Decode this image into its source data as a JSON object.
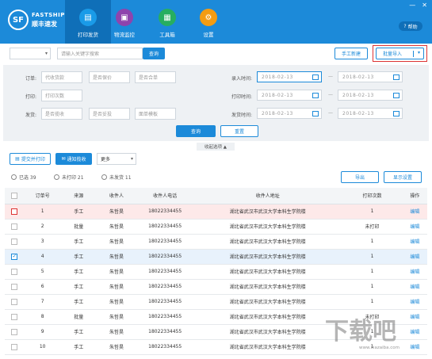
{
  "app": {
    "logo_mark": "SF",
    "logo_en": "FASTSHIP",
    "logo_cn": "顺丰速发"
  },
  "nav": [
    {
      "label": "打印发货",
      "icon": "printer-icon",
      "color": "#1a9be8"
    },
    {
      "label": "物流监控",
      "icon": "monitor-icon",
      "color": "#8e44ad"
    },
    {
      "label": "工具箱",
      "icon": "toolbox-icon",
      "color": "#27ae60"
    },
    {
      "label": "设置",
      "icon": "gear-icon",
      "color": "#f39c12"
    }
  ],
  "window": {
    "minimize": "—",
    "close": "✕"
  },
  "help_label": "帮助",
  "toolbar": {
    "search_placeholder": "请输入关键字搜索",
    "search_btn": "查询",
    "manual_new": "手工新建",
    "batch_import": "批量导入"
  },
  "filters": {
    "order_label": "订单:",
    "order_selects": [
      "代收货款",
      "是否保价",
      "是否合单"
    ],
    "print_label": "打印:",
    "print_selects": [
      "打印次数"
    ],
    "ship_label": "发货:",
    "ship_selects": [
      "是否揽收",
      "是否妥投",
      "面单模板"
    ],
    "entry_time_label": "录入时间:",
    "print_time_label": "打印时间:",
    "ship_time_label": "发货时间:",
    "date_from": "2018-02-13",
    "date_to": "2018-02-13",
    "query_btn": "查询",
    "reset_btn": "重置",
    "collapse": "收起选项 ▲"
  },
  "actions": {
    "submit_print": "提交并打印",
    "notify_pickup": "通知揽收",
    "more": "更多"
  },
  "status_tabs": {
    "selected": "已选 39",
    "unprinted": "未打印 21",
    "unshipped": "未发货 11"
  },
  "right_actions": {
    "export": "导出",
    "display_settings": "显示设置"
  },
  "table": {
    "headers": [
      "订单号",
      "来源",
      "收件人",
      "收件人电话",
      "收件人地址",
      "打印次数",
      "操作"
    ],
    "rows": [
      {
        "no": "1",
        "source": "手工",
        "name": "朱哲昊",
        "phone": "18022334455",
        "addr": "湖北省武汉市武汉大学本科生学院楼",
        "prints": "1",
        "op": "编辑"
      },
      {
        "no": "2",
        "source": "批量",
        "name": "朱哲昊",
        "phone": "18022334455",
        "addr": "湖北省武汉市武汉大学本科生学院楼",
        "prints": "未打印",
        "op": "编辑"
      },
      {
        "no": "3",
        "source": "手工",
        "name": "朱哲昊",
        "phone": "18022334455",
        "addr": "湖北省武汉市武汉大学本科生学院楼",
        "prints": "1",
        "op": "编辑"
      },
      {
        "no": "4",
        "source": "手工",
        "name": "朱哲昊",
        "phone": "18022334455",
        "addr": "湖北省武汉市武汉大学本科生学院楼",
        "prints": "1",
        "op": "编辑"
      },
      {
        "no": "5",
        "source": "手工",
        "name": "朱哲昊",
        "phone": "18022334455",
        "addr": "湖北省武汉市武汉大学本科生学院楼",
        "prints": "1",
        "op": "编辑"
      },
      {
        "no": "6",
        "source": "手工",
        "name": "朱哲昊",
        "phone": "18022334455",
        "addr": "湖北省武汉市武汉大学本科生学院楼",
        "prints": "1",
        "op": "编辑"
      },
      {
        "no": "7",
        "source": "手工",
        "name": "朱哲昊",
        "phone": "18022334455",
        "addr": "湖北省武汉市武汉大学本科生学院楼",
        "prints": "1",
        "op": "编辑"
      },
      {
        "no": "8",
        "source": "批量",
        "name": "朱哲昊",
        "phone": "18022334455",
        "addr": "湖北省武汉市武汉大学本科生学院楼",
        "prints": "未打印",
        "op": "编辑"
      },
      {
        "no": "9",
        "source": "手工",
        "name": "朱哲昊",
        "phone": "18022334455",
        "addr": "湖北省武汉市武汉大学本科生学院楼",
        "prints": "1",
        "op": "编辑"
      },
      {
        "no": "10",
        "source": "手工",
        "name": "朱哲昊",
        "phone": "18022334455",
        "addr": "湖北省武汉市武汉大学本科生学院楼",
        "prints": "1",
        "op": "编辑"
      }
    ]
  },
  "watermark": {
    "text": "下载吧",
    "url": "www.xiazaiba.com"
  }
}
